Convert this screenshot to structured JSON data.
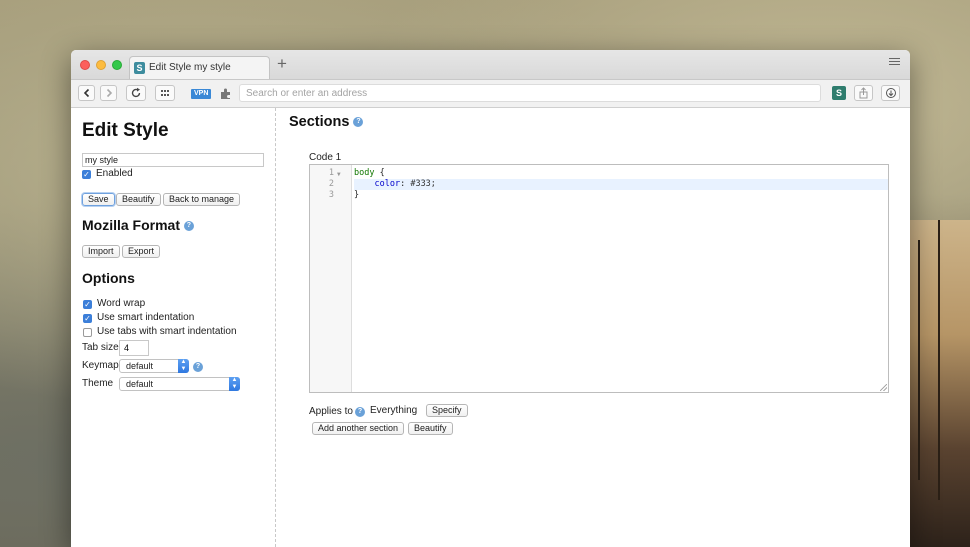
{
  "browser": {
    "tab_title": "Edit Style my style",
    "new_tab_label": "+",
    "url_placeholder": "Search or enter an address",
    "vpn_label": "VPN",
    "tab_favicon_letter": "S",
    "extension_icon_letter": "S"
  },
  "sidebar": {
    "title": "Edit Style",
    "style_name": "my style",
    "enabled_label": "Enabled",
    "enabled_checked": true,
    "buttons": {
      "save": "Save",
      "beautify": "Beautify",
      "back": "Back to manage"
    },
    "mozilla_title": "Mozilla Format",
    "import_label": "Import",
    "export_label": "Export",
    "options_title": "Options",
    "options": [
      {
        "label": "Word wrap",
        "checked": true
      },
      {
        "label": "Use smart indentation",
        "checked": true
      },
      {
        "label": "Use tabs with smart indentation",
        "checked": false
      }
    ],
    "tab_size_label": "Tab size",
    "tab_size_value": "4",
    "keymap_label": "Keymap",
    "keymap_value": "default",
    "theme_label": "Theme",
    "theme_value": "default"
  },
  "main": {
    "sections_title": "Sections",
    "code_label": "Code 1",
    "line_numbers": [
      "1",
      "2",
      "3"
    ],
    "code": {
      "line1_selector": "body",
      "line1_brace": " {",
      "line2_indent": "    ",
      "line2_prop": "color",
      "line2_colon": ": ",
      "line2_value": "#333;",
      "line3": "}"
    },
    "applies_to_label": "Applies to",
    "applies_to_value": "Everything",
    "specify_label": "Specify",
    "add_section_label": "Add another section",
    "beautify_label": "Beautify"
  },
  "help_glyph": "?",
  "colors": {
    "accent": "#3c7fd9",
    "help": "#6aa1d8"
  }
}
